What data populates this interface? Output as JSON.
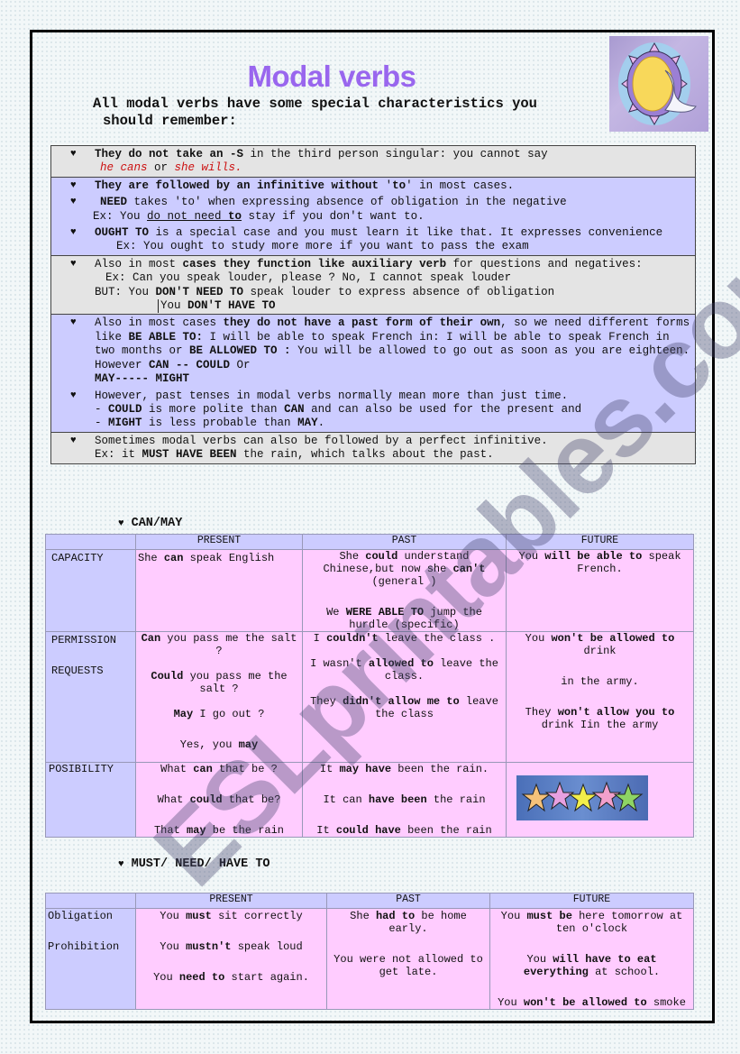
{
  "title": "Modal verbs",
  "intro": {
    "line1": "All modal verbs have some special characteristics you",
    "line2": "should remember:"
  },
  "bullet_icon": "heart-icon",
  "rules": {
    "r1": {
      "b1": "They do not take an -S",
      "t1": " in the third person singular: you cannot say",
      "ex1": "he cans",
      "or": " or ",
      "ex2": "she wills."
    },
    "r2": {
      "a_b": "They are followed by an infinitive without ",
      "a_q1": "'",
      "a_to": "to",
      "a_q2": "'",
      "a_t": " in most cases.",
      "b_b": "NEED",
      "b_t": " takes 'to' when expressing absence of obligation in the negative",
      "b_ex_pre": "Ex: You ",
      "b_ex_u1": "do not need ",
      "b_ex_u2": "to",
      "b_ex_post": " stay if you don't want to.",
      "c_b": "OUGHT TO",
      "c_t": " is a special case and you must learn it like that. It expresses convenience",
      "c_ex": "Ex: You ought to study more more if you want to pass the exam"
    },
    "r3": {
      "t1": "Also in most ",
      "b1": "cases they function like auxiliary  verb",
      "t2": "  for questions and negatives:",
      "ex": "Ex: Can you speak louder, please ? No, I cannot speak louder",
      "but_pre": "BUT: You ",
      "but_b": "DON'T NEED TO",
      "but_post": "  speak louder to express absence of obligation",
      "alt_pre": "You ",
      "alt_b": "DON'T HAVE TO"
    },
    "r4": {
      "a_t1": "Also in most cases ",
      "a_b1": "they do not have a past form of their own",
      "a_t2": ", so we need different forms like  ",
      "a_b2": "BE ABLE TO:",
      "a_t3": " I will be able to speak French in: I will be able to speak French in  two months or ",
      "a_b3": "BE ALLOWED TO :",
      "a_t4": " You will be allowed to go out as soon as you are eighteen. However     ",
      "a_b4": "CAN  -- COULD",
      "a_t5": "      Or ",
      "a_b5": "MAY----- MIGHT",
      "b_t1": "However, past tenses in modal verbs normally mean more than just time.",
      "b_l2_pre": "- ",
      "b_l2_b1": "COULD",
      "b_l2_t": " is more polite than ",
      "b_l2_b2": "CAN",
      "b_l2_post": "  and can also be used for the present and",
      "b_l3_pre": "- ",
      "b_l3_b1": "MIGHT",
      "b_l3_t": " is less probable than ",
      "b_l3_b2": "MAY",
      "b_l3_post": "."
    },
    "r5": {
      "t1": "Sometimes modal verbs can also be followed by a perfect infinitive.",
      "ex_pre": "Ex: it ",
      "ex_b": "MUST HAVE BEEN",
      "ex_post": " the rain, which talks about the past."
    }
  },
  "can_may": {
    "heading": "CAN/MAY",
    "columns": [
      "",
      "PRESENT",
      "PAST",
      "FUTURE"
    ],
    "rows": {
      "capacity": {
        "label": "CAPACITY",
        "present": {
          "t1": "She ",
          "b1": "can",
          "t2": " speak English"
        },
        "past": {
          "p1_t1": "She ",
          "p1_b1": "could",
          "p1_t2": " understand Chinese,but now she ",
          "p1_b2": "can't",
          "p1_t3": "(general )",
          "p2_t1": "We ",
          "p2_b1": "WERE ABLE TO",
          "p2_t2": " jump the hurdle (specific)"
        },
        "future": {
          "t1": "You ",
          "b1": "will be able to",
          "t2": " speak French."
        }
      },
      "permission": {
        "label1": "PERMISSION",
        "label2": "REQUESTS",
        "present": {
          "p1_b": "Can",
          "p1_t": " you pass me the salt ?",
          "p2_b": "Could",
          "p2_t": " you pass me the salt ?",
          "p3_b": "May",
          "p3_t": " I go out ?",
          "p4_t": "Yes, you ",
          "p4_b": "may"
        },
        "past": {
          "p1_t1": "I ",
          "p1_b": "couldn't",
          "p1_t2": " leave the class .",
          "p2_t1": "I wasn't ",
          "p2_b": "allowed to",
          "p2_t2": " leave the class.",
          "p3_t1": "They ",
          "p3_b": "didn't allow me to",
          "p3_t2": " leave the class"
        },
        "future": {
          "p1_t1": "You ",
          "p1_b": "won't be allowed to",
          "p1_t2": " drink",
          "p2_t": "in the army.",
          "p3_t1": "They ",
          "p3_b": "won't allow you to",
          "p3_t2": " drink  Iin the army"
        }
      },
      "possibility": {
        "label": "POSIBILITY",
        "present": {
          "p1_t1": "What ",
          "p1_b": "can",
          "p1_t2": " that be ?",
          "p2_t1": "What ",
          "p2_b": "could",
          "p2_t2": " that be?",
          "p3_t1": "That ",
          "p3_b": "may",
          "p3_t2": " be the rain"
        },
        "past": {
          "p1_t1": "It ",
          "p1_b": "may have",
          "p1_t2": " been the rain.",
          "p2_t1": "It can ",
          "p2_b": "have been",
          "p2_t2": " the rain",
          "p3_t1": "It ",
          "p3_b": "could have",
          "p3_t2": " been the rain"
        },
        "future_image": "stars-image"
      }
    }
  },
  "must_need": {
    "heading": "MUST/ NEED/ HAVE TO",
    "columns": [
      "",
      "PRESENT",
      "PAST",
      "FUTURE"
    ],
    "row": {
      "label1": "Obligation",
      "label2": "Prohibition",
      "present": {
        "p1_t1": "You ",
        "p1_b": "must",
        "p1_t2": " sit correctly",
        "p2_t1": "You ",
        "p2_b": "mustn't",
        "p2_t2": " speak loud",
        "p3_t1": "You ",
        "p3_b": "need to",
        "p3_t2": " start again."
      },
      "past": {
        "p1_t1": "She ",
        "p1_b": "had to",
        "p1_t2": " be home early.",
        "p2_t": "You were  not allowed to get late."
      },
      "future": {
        "p1_t1": "You ",
        "p1_b": "must be",
        "p1_t2": " here tomorrow at ten o'clock",
        "p2_t1": "You ",
        "p2_b": "will have to eat everything",
        "p2_t2": " at school.",
        "p3_t1": "You ",
        "p3_b": "won't be allowed to",
        "p3_t2": " smoke"
      }
    }
  },
  "watermark": "ESLprintables.com",
  "colors": {
    "title": "#9966ee",
    "grey_box": "#e4e4e4",
    "blue_box": "#ccccff",
    "pink_cell": "#ffccff",
    "red_example": "#cc1111"
  }
}
